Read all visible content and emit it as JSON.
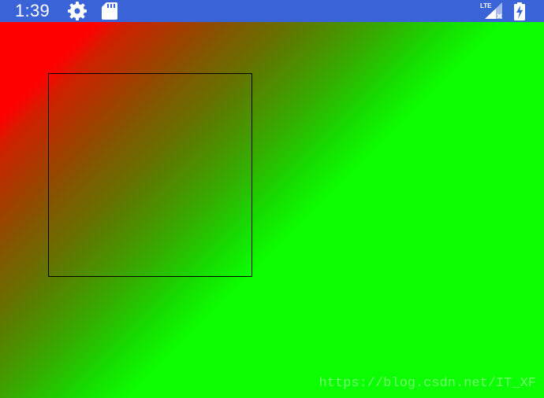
{
  "status_bar": {
    "time": "1:39",
    "background_color": "#3a63d8",
    "left_icons": [
      "gear-icon",
      "sd-card-icon"
    ],
    "right_icons": [
      "lte-signal-icon",
      "battery-charging-icon"
    ],
    "lte_label": "LTE"
  },
  "canvas": {
    "gradient_start_color": "#ff0000",
    "gradient_end_color": "#0cff00",
    "gradient_direction": "top-left to bottom-right",
    "outlined_shape": "square"
  },
  "watermark": {
    "text": "https://blog.csdn.net/IT_XF"
  }
}
